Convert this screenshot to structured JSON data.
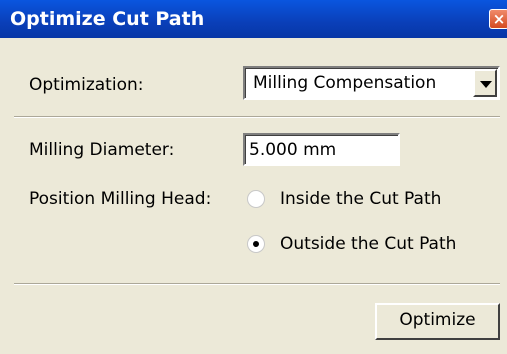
{
  "window": {
    "title": "Optimize Cut Path",
    "close_glyph": "×"
  },
  "optimization": {
    "label": "Optimization:",
    "selected": "Milling Compensation"
  },
  "milling_diameter": {
    "label": "Milling Diameter:",
    "value": "5.000 mm"
  },
  "position_milling_head": {
    "label": "Position Milling Head:",
    "options": [
      {
        "label": "Inside the Cut Path",
        "checked": false
      },
      {
        "label": "Outside the Cut Path",
        "checked": true
      }
    ]
  },
  "actions": {
    "optimize_label": "Optimize"
  }
}
